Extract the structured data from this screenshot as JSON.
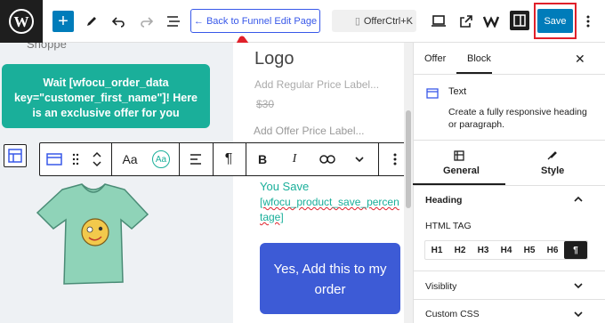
{
  "topbar": {
    "back_label": "← Back to Funnel Edit Page",
    "doc_title": "OfferCtrl+K",
    "save_label": "Save"
  },
  "canvas": {
    "shoppe_text": "Shoppe",
    "teal_line1": "Wait [wfocu_order_data key=\"customer_first_name\"]! Here is an exclusive offer for you",
    "logo": "Logo",
    "regular_price_placeholder": "Add Regular Price Label...",
    "strike_price": "$30",
    "offer_price_placeholder": "Add Offer Price Label...",
    "you_save": "You Save",
    "save_percentage": "[wfocu_product_save_percentage]",
    "yes_button": "Yes, Add this to my order"
  },
  "block_toolbar": {
    "font_size_label": "Aa",
    "color_label": "Aa",
    "paragraph_symbol": "¶",
    "bold": "B",
    "italic": "I"
  },
  "sidebar": {
    "tabs": [
      "Offer",
      "Block"
    ],
    "block_name": "Text",
    "block_description": "Create a fully responsive heading or paragraph.",
    "subtabs": [
      "General",
      "Style"
    ],
    "heading_section": "Heading",
    "html_tag_label": "HTML TAG",
    "html_tags": [
      "H1",
      "H2",
      "H3",
      "H4",
      "H5",
      "H6",
      "¶"
    ],
    "selected_tag": "¶",
    "visibility_label": "Visiblity",
    "custom_css_label": "Custom CSS"
  },
  "colors": {
    "accent": "#007cba",
    "teal": "#1aaf9a",
    "button_blue": "#3d5bd6",
    "highlight": "#e0202a"
  }
}
